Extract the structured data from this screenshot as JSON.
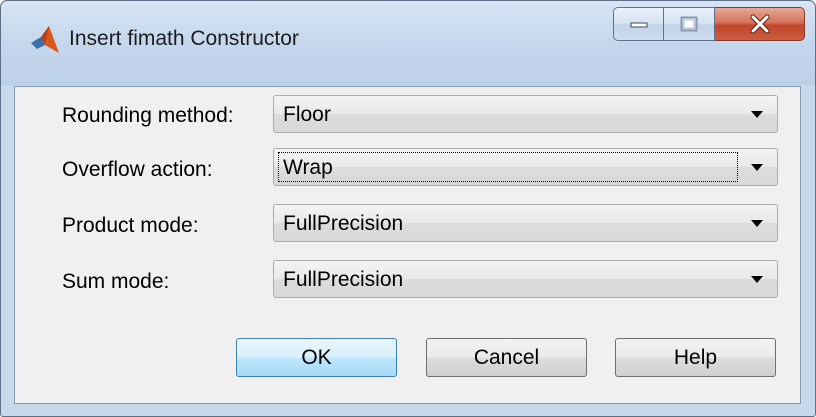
{
  "window": {
    "title": "Insert fimath Constructor",
    "icon": "matlab-membrane-icon",
    "caption_buttons": [
      "minimize-icon",
      "maximize-icon",
      "close-icon"
    ]
  },
  "form": {
    "rounding": {
      "label": "Rounding method:",
      "value": "Floor"
    },
    "overflow": {
      "label": "Overflow action:",
      "value": "Wrap"
    },
    "product": {
      "label": "Product mode:",
      "value": "FullPrecision"
    },
    "sum": {
      "label": "Sum mode:",
      "value": "FullPrecision"
    }
  },
  "buttons": {
    "ok": "OK",
    "cancel": "Cancel",
    "help": "Help"
  },
  "colors": {
    "titlebar": "#c5d7ed",
    "client": "#f0f0f0",
    "close_button": "#c1452a",
    "default_button_border": "#3c7fb1"
  }
}
